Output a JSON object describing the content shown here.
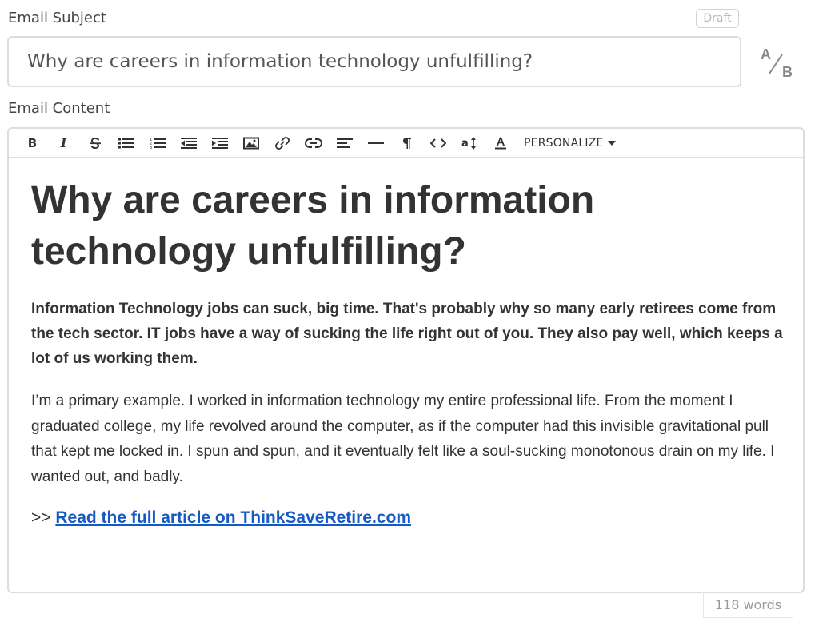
{
  "subject": {
    "label": "Email Subject",
    "badge": "Draft",
    "value": "Why are careers in information technology unfulfilling?"
  },
  "content": {
    "label": "Email Content",
    "toolbar": {
      "bold_label": "B",
      "italic_label": "I",
      "personalize_label": "PERSONALIZE",
      "icons": [
        "bold-icon",
        "italic-icon",
        "strikethrough-icon",
        "bulleted-list-icon",
        "numbered-list-icon",
        "outdent-icon",
        "indent-icon",
        "image-icon",
        "link-icon",
        "unlink-icon",
        "align-left-icon",
        "horizontal-rule-icon",
        "paragraph-icon",
        "code-icon",
        "text-size-icon",
        "text-color-icon"
      ]
    },
    "body": {
      "title": "Why are careers in information technology unfulfilling?",
      "lead": "Information Technology jobs can suck, big time. That's probably why so many early retirees come from the tech sector. IT jobs have a way of sucking the life right out of you. They also pay well, which keeps a lot of us working them.",
      "paragraph": "I’m a primary example. I worked in information technology my entire professional life. From the moment I graduated college, my life revolved around the computer, as if the computer had this invisible gravitational pull that kept me locked in. I spun and spun, and it eventually felt like a soul-sucking monotonous drain on my life. I wanted out, and badly.",
      "readmore_prefix": ">> ",
      "readmore_link": "Read the full article on ThinkSaveRetire.com"
    }
  },
  "ab_test": {
    "top": "A",
    "bottom": "B"
  },
  "word_count": "118 words",
  "colors": {
    "link": "#1559c7",
    "border": "#dddddd",
    "text": "#333333"
  }
}
